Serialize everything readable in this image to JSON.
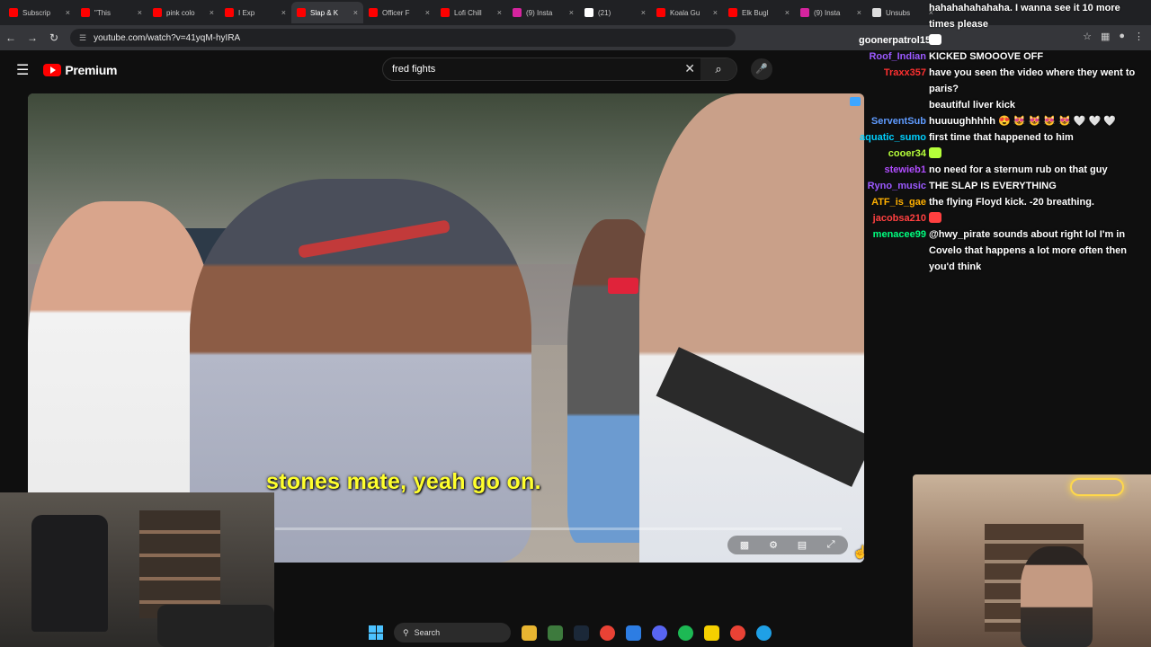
{
  "browser": {
    "tabs": [
      {
        "label": "Subscrip",
        "color": "#ff0000",
        "active": false
      },
      {
        "label": "\"This",
        "color": "#ff0000",
        "active": false
      },
      {
        "label": "pink colo",
        "color": "#ff0000",
        "active": false
      },
      {
        "label": "I Exp",
        "color": "#ff0000",
        "active": false
      },
      {
        "label": "Slap & K",
        "color": "#ff0000",
        "active": true
      },
      {
        "label": "Officer F",
        "color": "#ff0000",
        "active": false
      },
      {
        "label": "Lofi Chill",
        "color": "#ff0000",
        "active": false
      },
      {
        "label": "(9) Insta",
        "color": "#d6249f",
        "active": false
      },
      {
        "label": "(21)",
        "color": "#ffffff",
        "active": false
      },
      {
        "label": "Koala Gu",
        "color": "#ff0000",
        "active": false
      },
      {
        "label": "Elk Bugl",
        "color": "#ff0000",
        "active": false
      },
      {
        "label": "(9) Insta",
        "color": "#d6249f",
        "active": false
      },
      {
        "label": "Unsubs",
        "color": "#dddddd",
        "active": false
      }
    ],
    "url": "youtube.com/watch?v=41yqM-hyIRA"
  },
  "youtube": {
    "brand": "Premium",
    "search_value": "fred fights"
  },
  "video": {
    "subtitle": "stones mate, yeah go on."
  },
  "chat": [
    {
      "name": "",
      "name_color": "#ff7f50",
      "text": "hahahahahahaha. I wanna see it 10 more times please"
    },
    {
      "name": "goonerpatrol15",
      "name_color": "#ffffff",
      "text": ""
    },
    {
      "name": "Roof_Indian",
      "name_color": "#9b59ff",
      "text": "KICKED SMOOOVE OFF"
    },
    {
      "name": "Traxx357",
      "name_color": "#ff3030",
      "text": "have you seen the video where they went to paris?"
    },
    {
      "name": "",
      "name_color": "#3030ff",
      "text": "beautiful liver kick"
    },
    {
      "name": "ServentSub",
      "name_color": "#5f9bff",
      "text": "huuuughhhhh 😍 😻 😻 😻 😻 🤍 🤍 🤍"
    },
    {
      "name": "aquatic_sumo",
      "name_color": "#00d0ff",
      "text": "first time that happened to him"
    },
    {
      "name": "cooer34",
      "name_color": "#b6ff3a",
      "text": ""
    },
    {
      "name": "stewieb1",
      "name_color": "#b04dff",
      "text": "no need for a sternum rub on that guy"
    },
    {
      "name": "Ryno_music",
      "name_color": "#9b59ff",
      "text": "THE SLAP IS EVERYTHING"
    },
    {
      "name": "ATF_is_gae",
      "name_color": "#ffb000",
      "text": "the flying Floyd kick. -20 breathing."
    },
    {
      "name": "jacobsa210",
      "name_color": "#ff4040",
      "text": ""
    },
    {
      "name": "menacee99",
      "name_color": "#00ff7f",
      "text": "@hwy_pirate sounds about right lol I'm in Covelo that happens a lot more often then you'd think"
    }
  ],
  "taskbar": {
    "search_label": "Search"
  },
  "icons": {
    "back": "←",
    "forward": "→",
    "reload": "↻",
    "menu": "☰",
    "clear": "✕",
    "search": "⌕",
    "mic": "•",
    "close": "×"
  }
}
